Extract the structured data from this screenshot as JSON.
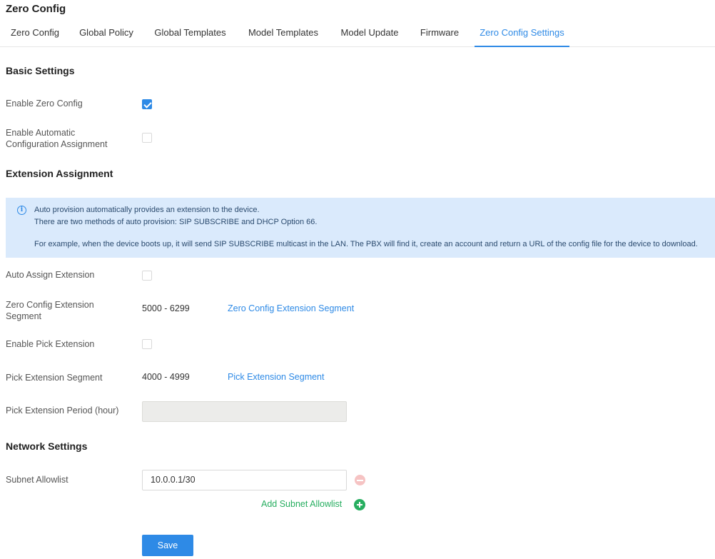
{
  "page_title": "Zero Config",
  "tabs": [
    {
      "label": "Zero Config",
      "active": false
    },
    {
      "label": "Global Policy",
      "active": false
    },
    {
      "label": "Global Templates",
      "active": false
    },
    {
      "label": "Model Templates",
      "active": false
    },
    {
      "label": "Model Update",
      "active": false
    },
    {
      "label": "Firmware",
      "active": false
    },
    {
      "label": "Zero Config Settings",
      "active": true
    }
  ],
  "basic_settings": {
    "title": "Basic Settings",
    "enable_zero_config": {
      "label": "Enable Zero Config",
      "checked": true
    },
    "enable_auto_config": {
      "label_line1": "Enable Automatic",
      "label_line2": "Configuration Assignment",
      "checked": false
    }
  },
  "extension_assignment": {
    "title": "Extension Assignment",
    "info": {
      "line1": "Auto provision automatically provides an extension to the device.",
      "line2": "There are two methods of auto provision: SIP SUBSCRIBE and DHCP Option 66.",
      "line3": "For example, when the device boots up, it will send SIP SUBSCRIBE multicast in the LAN. The PBX will find it, create an account and return a URL of the config file for the device to download."
    },
    "auto_assign": {
      "label": "Auto Assign Extension",
      "checked": false
    },
    "zero_config_segment": {
      "label_line1": "Zero Config Extension",
      "label_line2": "Segment",
      "value": "5000 - 6299",
      "link": "Zero Config Extension Segment"
    },
    "enable_pick": {
      "label": "Enable Pick Extension",
      "checked": false
    },
    "pick_segment": {
      "label": "Pick Extension Segment",
      "value": "4000 - 4999",
      "link": "Pick Extension Segment"
    },
    "pick_period": {
      "label": "Pick Extension Period (hour)",
      "value": ""
    }
  },
  "network_settings": {
    "title": "Network Settings",
    "subnet_allowlist": {
      "label": "Subnet Allowlist",
      "value": "10.0.0.1/30"
    },
    "add_label": "Add Subnet Allowlist"
  },
  "save_label": "Save",
  "colors": {
    "accent": "#2e8ae6",
    "success": "#27ae60",
    "info_bg": "#daeafc",
    "danger_light": "#f6c3c3"
  }
}
